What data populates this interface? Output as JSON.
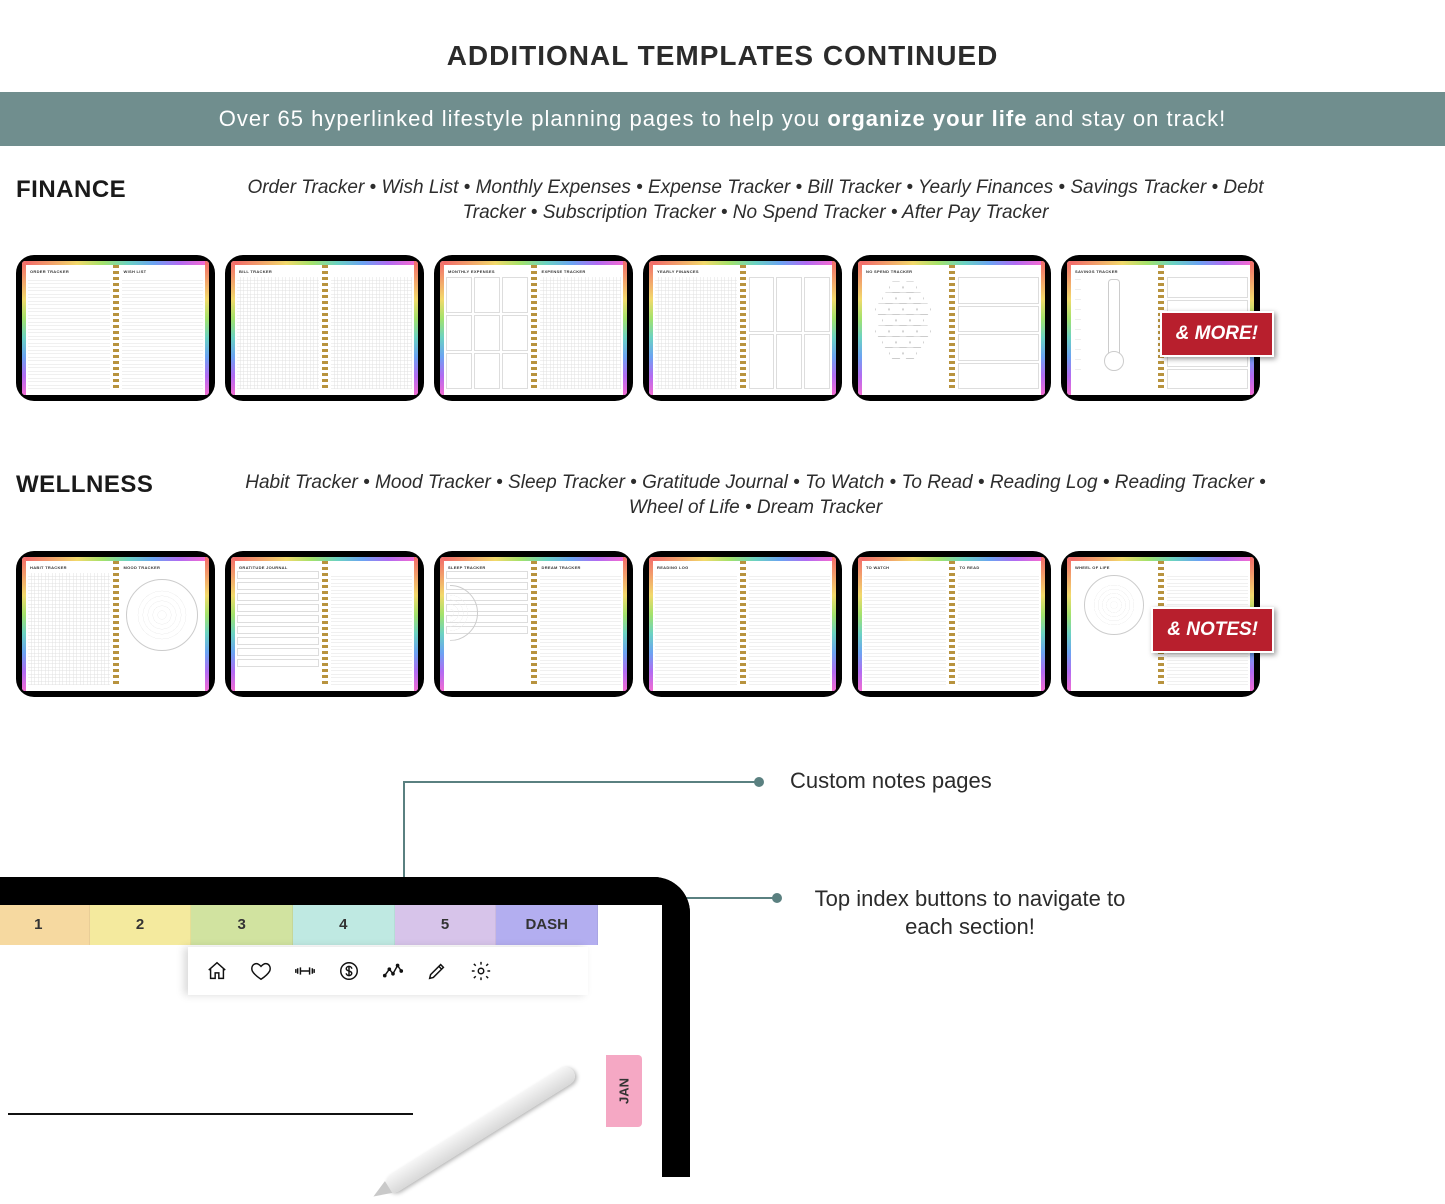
{
  "title": "ADDITIONAL TEMPLATES CONTINUED",
  "banner": {
    "pre": "Over 65 hyperlinked lifestyle planning pages to help you ",
    "bold": "organize your life",
    "post": " and stay on track!"
  },
  "sections": [
    {
      "label": "FINANCE",
      "desc": "Order Tracker • Wish List • Monthly Expenses • Expense Tracker • Bill Tracker • Yearly Finances • Savings Tracker • Debt Tracker • Subscription Tracker • No Spend Tracker • After Pay Tracker",
      "badge": "& MORE!",
      "thumbs": [
        {
          "left": "ORDER TRACKER",
          "right": "WISH LIST",
          "style": "lines"
        },
        {
          "left": "BILL TRACKER",
          "right": "",
          "style": "grid"
        },
        {
          "left": "MONTHLY EXPENSES",
          "right": "EXPENSE TRACKER",
          "style": "boxes"
        },
        {
          "left": "YEARLY FINANCES",
          "right": "",
          "style": "grid-wide"
        },
        {
          "left": "NO SPEND TRACKER",
          "right": "",
          "style": "hex"
        },
        {
          "left": "SAVINGS TRACKER",
          "right": "",
          "style": "thermo"
        }
      ]
    },
    {
      "label": "WELLNESS",
      "desc": "Habit Tracker • Mood Tracker • Sleep Tracker • Gratitude Journal • To Watch • To Read • Reading Log • Reading Tracker • Wheel of Life • Dream Tracker",
      "badge": "& NOTES!",
      "thumbs": [
        {
          "left": "HABIT TRACKER",
          "right": "MOOD TRACKER",
          "style": "radial"
        },
        {
          "left": "GRATITUDE JOURNAL",
          "right": "",
          "style": "form"
        },
        {
          "left": "SLEEP TRACKER",
          "right": "DREAM TRACKER",
          "style": "half-radial"
        },
        {
          "left": "READING LOG",
          "right": "",
          "style": "lines"
        },
        {
          "left": "TO WATCH",
          "right": "TO READ",
          "style": "lines"
        },
        {
          "left": "WHEEL OF LIFE",
          "right": "",
          "style": "radial-small"
        }
      ]
    }
  ],
  "hero": {
    "callout_notes": "Custom notes pages",
    "callout_index": "Top index buttons to navigate to each section!",
    "tabs": [
      "1",
      "2",
      "3",
      "4",
      "5",
      "DASH"
    ],
    "side_tab": "JAN",
    "icons": [
      {
        "name": "home-icon"
      },
      {
        "name": "heart-icon"
      },
      {
        "name": "dumbbell-icon"
      },
      {
        "name": "dollar-icon"
      },
      {
        "name": "trend-icon"
      },
      {
        "name": "pencil-icon"
      },
      {
        "name": "gear-icon"
      }
    ]
  }
}
